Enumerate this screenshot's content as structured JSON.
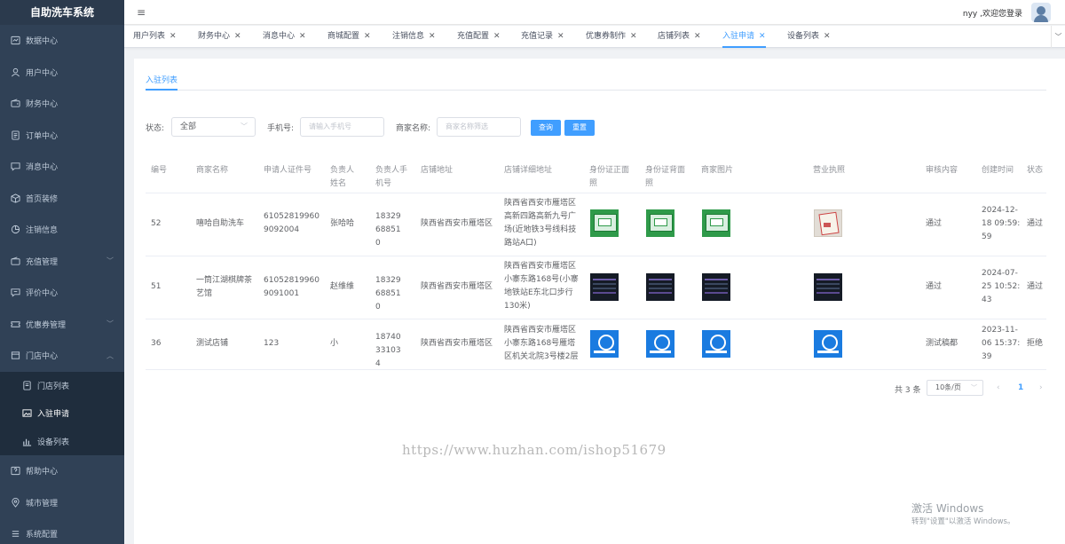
{
  "app": {
    "title": "自助洗车系统"
  },
  "sidebar": {
    "items": [
      {
        "label": "数据中心",
        "icon": "dashboard-icon"
      },
      {
        "label": "用户中心",
        "icon": "user-icon"
      },
      {
        "label": "财务中心",
        "icon": "wallet-icon"
      },
      {
        "label": "订单中心",
        "icon": "document-icon"
      },
      {
        "label": "消息中心",
        "icon": "chat-icon"
      },
      {
        "label": "首页装修",
        "icon": "box-icon"
      },
      {
        "label": "注销信息",
        "icon": "piechart-icon"
      },
      {
        "label": "充值管理",
        "icon": "wallet-icon"
      },
      {
        "label": "评价中心",
        "icon": "chat-icon"
      },
      {
        "label": "优惠券管理",
        "icon": "ticket-icon"
      },
      {
        "label": "门店中心",
        "icon": "store-icon"
      }
    ],
    "store_sub": [
      {
        "label": "门店列表",
        "icon": "document-icon"
      },
      {
        "label": "入驻申请",
        "icon": "picture-icon"
      },
      {
        "label": "设备列表",
        "icon": "barchart-icon"
      }
    ],
    "bottom_items": [
      {
        "label": "帮助中心",
        "icon": "help-icon"
      },
      {
        "label": "城市管理",
        "icon": "location-icon"
      },
      {
        "label": "系统配置",
        "icon": "settings-icon"
      }
    ]
  },
  "header": {
    "welcome": "nyy ,欢迎您登录"
  },
  "tabs": [
    "用户列表",
    "财务中心",
    "消息中心",
    "商城配置",
    "注销信息",
    "充值配置",
    "充值记录",
    "优惠券制作",
    "店铺列表",
    "入驻申请",
    "设备列表"
  ],
  "active_tab": "入驻申请",
  "page": {
    "inner_tab": "入驻列表"
  },
  "filter": {
    "status_label": "状态:",
    "status_value": "全部",
    "phone_label": "手机号:",
    "phone_placeholder": "请输入手机号",
    "name_label": "商家名称:",
    "name_placeholder": "商家名称筛选",
    "search_btn": "查询",
    "reset_btn": "重置"
  },
  "table": {
    "headers": [
      "编号",
      "商家名称",
      "申请人证件号",
      "负责人姓名",
      "负责人手机号",
      "店铺地址",
      "店铺详细地址",
      "身份证正面照",
      "身份证背面照",
      "商家图片",
      "营业执照",
      "审核内容",
      "创建时间",
      "状态"
    ],
    "rows": [
      {
        "id": "52",
        "name": "嘻哈自助洗车",
        "idcard": "610528199609092004",
        "owner": "张哈哈",
        "phone": "18329688510",
        "addr": "陕西省西安市雁塔区",
        "detail": "陕西省西安市雁塔区高新四路高新九号广场(近地铁3号线科技路站A口)",
        "audit": "通过",
        "created": "2024-12-18 09:59:59",
        "status": "通过",
        "img_front": "green",
        "img_back": "green",
        "img_shop": "green",
        "img_license": "photo"
      },
      {
        "id": "51",
        "name": "一筒江湖棋牌茶艺馆",
        "idcard": "610528199609091001",
        "owner": "赵维维",
        "phone": "18329688510",
        "addr": "陕西省西安市雁塔区",
        "detail": "陕西省西安市雁塔区小寨东路168号(小寨地铁站E东北口步行130米)",
        "audit": "通过",
        "created": "2024-07-25 10:52:43",
        "status": "通过",
        "img_front": "dark",
        "img_back": "dark",
        "img_shop": "dark",
        "img_license": "dark"
      },
      {
        "id": "36",
        "name": "测试店铺",
        "idcard": "123",
        "owner": "小",
        "phone": "18740331034",
        "addr": "陕西省西安市雁塔区",
        "detail": "陕西省西安市雁塔区小寨东路168号雁塔区机关北院3号楼2层",
        "audit": "测试稿都",
        "created": "2023-11-06 15:37:39",
        "status": "拒绝",
        "img_front": "blue",
        "img_back": "blue",
        "img_shop": "blue",
        "img_license": "blue"
      }
    ]
  },
  "pagination": {
    "total": "共 3 条",
    "page_size": "10条/页",
    "current": "1"
  },
  "watermark": {
    "url": "https://www.huzhan.com/ishop51679",
    "win_title": "激活 Windows",
    "win_sub": "转到\"设置\"以激活 Windows。"
  },
  "colors": {
    "accent": "#409eff",
    "sidebar_bg": "#304156",
    "sidebar_sub_bg": "#1f2d3d"
  }
}
